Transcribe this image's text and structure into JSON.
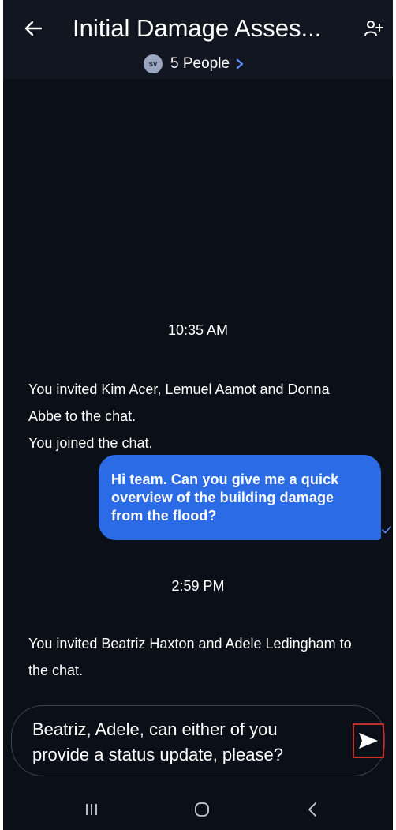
{
  "header": {
    "title": "Initial Damage Asses...",
    "people_label": "5 People",
    "avatar_initials": "SV"
  },
  "chat": {
    "groups": [
      {
        "timestamp": "10:35 AM",
        "system_messages": [
          "You invited Kim Acer, Lemuel Aamot and Donna Abbe to the chat.",
          "You joined the chat."
        ]
      },
      {
        "timestamp": "2:59 PM",
        "system_messages": [
          "You invited Beatriz Haxton and Adele Ledingham to the chat."
        ]
      }
    ],
    "outgoing_message": "Hi team. Can you give me a quick overview of the building damage from the flood?"
  },
  "composer": {
    "text": "Beatriz, Adele, can either of you provide a status update, please?"
  },
  "icons": {
    "back": "arrow-left-icon",
    "add_person": "add-person-icon",
    "chevron": "chevron-right-icon",
    "read": "checkmark-icon",
    "send": "send-icon",
    "recents": "recents-icon",
    "home": "home-icon",
    "nav_back": "nav-back-icon"
  },
  "colors": {
    "background": "#0b0f17",
    "header": "#111621",
    "bubble": "#2b6be6",
    "accent": "#5b8cff",
    "send_highlight": "#c0302c"
  }
}
